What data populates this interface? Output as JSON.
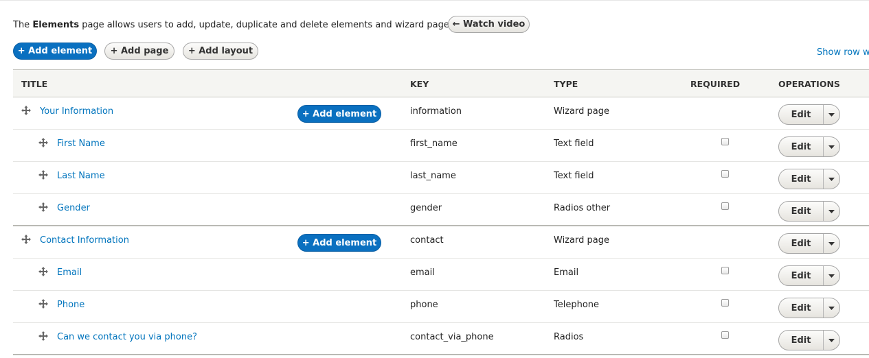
{
  "intro": {
    "prefix": "The",
    "bold": "Elements",
    "suffix": "page allows users to add, update, duplicate and delete elements and wizard pages.",
    "watch_label": "← Watch video"
  },
  "actions": {
    "add_element": "+ Add element",
    "add_page": "+ Add page",
    "add_layout": "+ Add layout"
  },
  "show_weights": "Show row we",
  "table": {
    "headers": {
      "title": "TITLE",
      "key": "KEY",
      "type": "TYPE",
      "required": "REQUIRED",
      "operations": "OPERATIONS"
    },
    "row_add_label": "+ Add element",
    "edit_label": "Edit",
    "rows": [
      {
        "title": "Your Information",
        "key": "information",
        "type": "Wizard page",
        "indent": 0,
        "is_page": true
      },
      {
        "title": "First Name",
        "key": "first_name",
        "type": "Text field",
        "indent": 1,
        "required": false
      },
      {
        "title": "Last Name",
        "key": "last_name",
        "type": "Text field",
        "indent": 1,
        "required": false
      },
      {
        "title": "Gender",
        "key": "gender",
        "type": "Radios other",
        "indent": 1,
        "required": false
      },
      {
        "title": "Contact Information",
        "key": "contact",
        "type": "Wizard page",
        "indent": 0,
        "is_page": true
      },
      {
        "title": "Email",
        "key": "email",
        "type": "Email",
        "indent": 1,
        "required": false
      },
      {
        "title": "Phone",
        "key": "phone",
        "type": "Telephone",
        "indent": 1,
        "required": false
      },
      {
        "title": "Can we contact you via phone?",
        "key": "contact_via_phone",
        "type": "Radios",
        "indent": 1,
        "required": false
      }
    ]
  },
  "colors": {
    "link": "#0074bd",
    "primary_button": "#0a70c0",
    "header_bg": "#f5f5f2"
  },
  "icons": {
    "drag": "move-arrows-icon",
    "dropdown": "caret-down-icon"
  }
}
